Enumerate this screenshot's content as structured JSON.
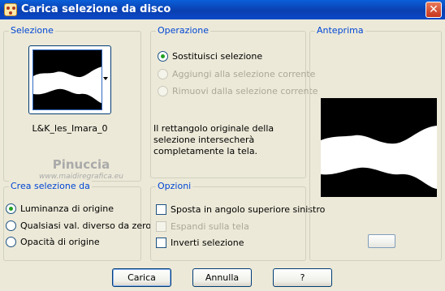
{
  "window": {
    "title": "Carica selezione da disco",
    "close_glyph": "✕"
  },
  "selezione": {
    "label": "Selezione",
    "selected_name": "L&K_les_Imara_0"
  },
  "operazione": {
    "label": "Operazione",
    "options": [
      {
        "label": "Sostituisci selezione",
        "selected": true,
        "enabled": true
      },
      {
        "label": "Aggiungi alla selezione corrente",
        "selected": false,
        "enabled": false
      },
      {
        "label": "Rimuovi dalla selezione corrente",
        "selected": false,
        "enabled": false
      }
    ],
    "info_text": "Il rettangolo originale della selezione intersecherà completamente la tela."
  },
  "crea": {
    "label": "Crea selezione da",
    "options": [
      {
        "label": "Luminanza di origine",
        "selected": true
      },
      {
        "label": "Qualsiasi val. diverso da zero",
        "selected": false
      },
      {
        "label": "Opacità di origine",
        "selected": false
      }
    ]
  },
  "opzioni": {
    "label": "Opzioni",
    "checks": [
      {
        "label": "Sposta in angolo superiore sinistro",
        "checked": false,
        "enabled": true
      },
      {
        "label": "Espandi sulla tela",
        "checked": false,
        "enabled": false
      },
      {
        "label": "Inverti selezione",
        "checked": false,
        "enabled": true
      }
    ]
  },
  "anteprima": {
    "label": "Anteprima"
  },
  "watermark": {
    "name": "Pinuccia",
    "url": "www.maidiregrafica.eu"
  },
  "buttons": {
    "carica": "Carica",
    "annulla": "Annulla",
    "help": "?"
  },
  "colors": {
    "title_bar": "#0a47c4",
    "group_label": "#0046d5",
    "dialog_bg": "#ece9d8"
  }
}
